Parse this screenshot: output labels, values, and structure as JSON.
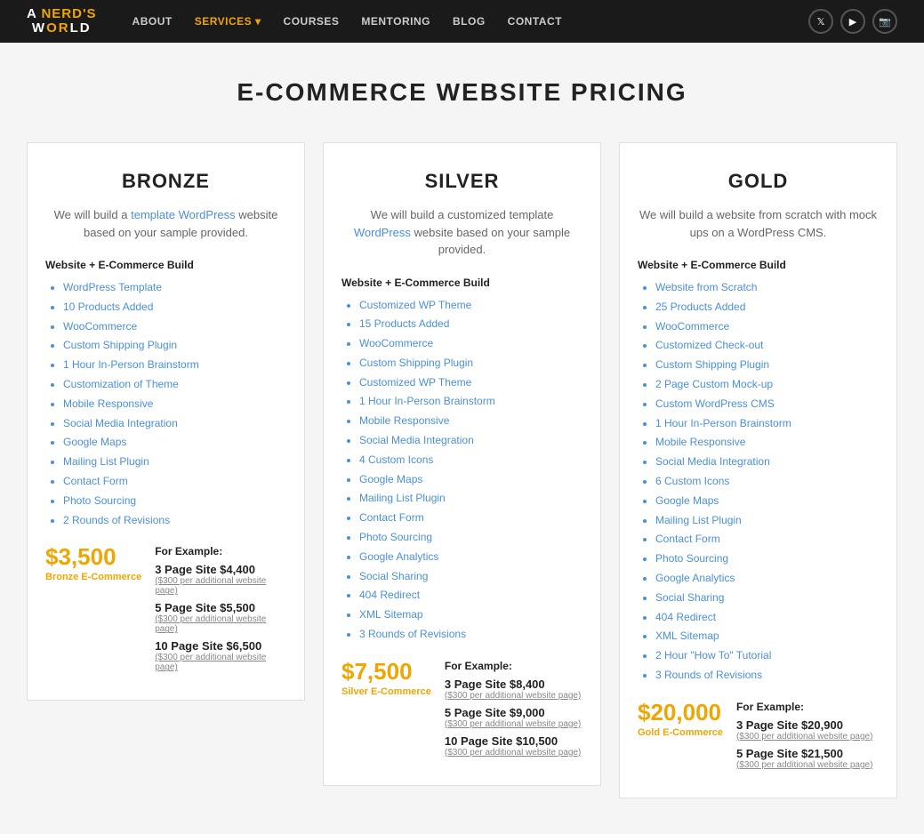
{
  "nav": {
    "logo_line1": "A NERD'S",
    "logo_line2": "WORLD",
    "links": [
      {
        "label": "ABOUT",
        "active": false
      },
      {
        "label": "SERVICES",
        "active": true,
        "dropdown": true
      },
      {
        "label": "COURSES",
        "active": false,
        "dropdown": true
      },
      {
        "label": "MENTORING",
        "active": false
      },
      {
        "label": "BLOG",
        "active": false
      },
      {
        "label": "CONTACT",
        "active": false
      }
    ],
    "icons": [
      "twitter",
      "youtube",
      "instagram"
    ]
  },
  "page": {
    "title": "E-COMMERCE WEBSITE PRICING"
  },
  "bronze": {
    "title": "BRONZE",
    "description_plain": "We will build a ",
    "description_link": "template WordPress",
    "description_end": " website based on your sample provided.",
    "section_label": "Website + E-Commerce Build",
    "features": [
      "WordPress Template",
      "10 Products Added",
      "WooCommerce",
      "Custom Shipping Plugin",
      "1 Hour In-Person Brainstorm",
      "Customization of Theme",
      "Mobile Responsive",
      "Social Media Integration",
      "Google Maps",
      "Mailing List Plugin",
      "Contact Form",
      "Photo Sourcing",
      "2 Rounds of Revisions"
    ],
    "example_label": "For Example:",
    "big_price": "$3,500",
    "big_price_label": "Bronze E-Commerce",
    "examples": [
      {
        "main": "3 Page Site $4,400",
        "sub": "($300 per additional website page)"
      },
      {
        "main": "5 Page Site $5,500",
        "sub": "($300 per additional website page)"
      },
      {
        "main": "10 Page Site $6,500",
        "sub": "($300 per additional website page)"
      }
    ]
  },
  "silver": {
    "title": "SILVER",
    "description": "We will build a customized template WordPress website based on your sample provided.",
    "section_label": "Website + E-Commerce Build",
    "features": [
      "Customized WP Theme",
      "15 Products Added",
      "WooCommerce",
      "Custom Shipping Plugin",
      "Customized WP Theme",
      "1 Hour In-Person Brainstorm",
      "Mobile Responsive",
      "Social Media Integration",
      "4 Custom Icons",
      "Google Maps",
      "Mailing List Plugin",
      "Contact Form",
      "Photo Sourcing",
      "Google Analytics",
      "Social Sharing",
      "404 Redirect",
      "XML Sitemap",
      "3 Rounds of Revisions"
    ],
    "example_label": "For Example:",
    "big_price": "$7,500",
    "big_price_label": "Silver E-Commerce",
    "examples": [
      {
        "main": "3 Page Site $8,400",
        "sub": "($300 per additional website page)"
      },
      {
        "main": "5 Page Site $9,000",
        "sub": "($300 per additional website page)"
      },
      {
        "main": "10 Page Site $10,500",
        "sub": "($300 per additional website page)"
      }
    ]
  },
  "gold": {
    "title": "GOLD",
    "description": "We will build a website from scratch with mock ups on a WordPress CMS.",
    "section_label": "Website + E-Commerce Build",
    "features": [
      "Website from Scratch",
      "25 Products Added",
      "WooCommerce",
      "Customized Check-out",
      "Custom Shipping Plugin",
      "2 Page Custom Mock-up",
      "Custom WordPress CMS",
      "1 Hour In-Person Brainstorm",
      "Mobile Responsive",
      "Social Media Integration",
      "6 Custom Icons",
      "Google Maps",
      "Mailing List Plugin",
      "Contact Form",
      "Photo Sourcing",
      "Google Analytics",
      "Social Sharing",
      "404 Redirect",
      "XML Sitemap",
      "2 Hour \"How To\" Tutorial",
      "3 Rounds of Revisions"
    ],
    "example_label": "For Example:",
    "big_price": "$20,000",
    "big_price_label": "Gold E-Commerce",
    "examples": [
      {
        "main": "3 Page Site $20,900",
        "sub": "($300 per additional website page)"
      },
      {
        "main": "5 Page Site $21,500",
        "sub": "($300 per additional website page)"
      }
    ]
  }
}
